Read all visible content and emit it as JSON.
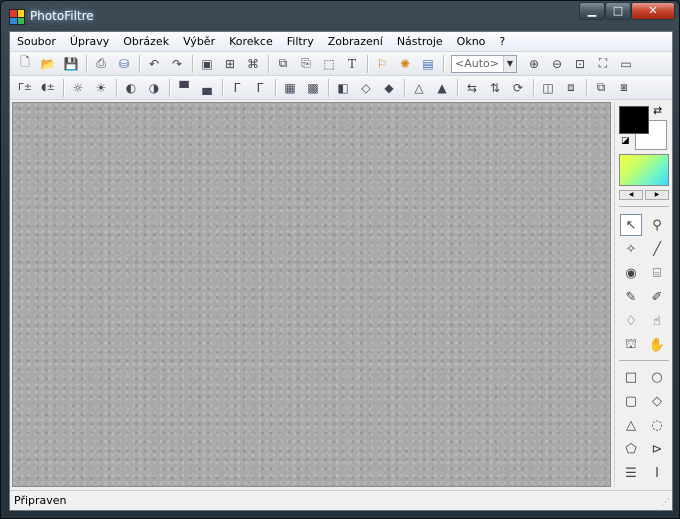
{
  "window": {
    "title": "PhotoFiltre",
    "icon": "photofiltre-app-icon",
    "caption_buttons": [
      {
        "name": "minimize-button",
        "glyph": "▁"
      },
      {
        "name": "maximize-button",
        "glyph": "□"
      },
      {
        "name": "close-button",
        "glyph": "✕"
      }
    ]
  },
  "menu": [
    "Soubor",
    "Úpravy",
    "Obrázek",
    "Výběr",
    "Korekce",
    "Filtry",
    "Zobrazení",
    "Nástroje",
    "Okno",
    "?"
  ],
  "toolbar1": {
    "zoom": {
      "value": "<Auto>"
    }
  },
  "palette": {
    "foreground_color": "#000000",
    "background_color": "#FFFFFF"
  },
  "status": {
    "text": "Připraven"
  }
}
